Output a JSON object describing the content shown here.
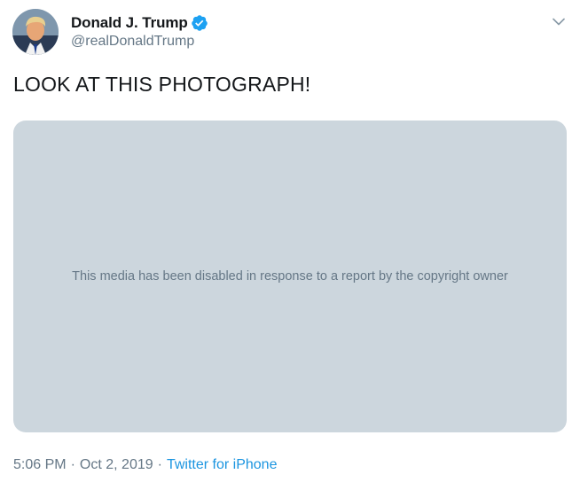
{
  "author": {
    "display_name": "Donald J. Trump",
    "handle": "@realDonaldTrump",
    "verified_icon": "verified-badge-icon",
    "avatar": "profile-photo"
  },
  "menu": {
    "icon": "chevron-down-icon"
  },
  "tweet": {
    "text": "LOOK AT THIS PHOTOGRAPH!"
  },
  "media": {
    "notice": "This media has been disabled in response to a report by the copyright owner"
  },
  "meta": {
    "time": "5:06 PM",
    "separator_1": "·",
    "date": "Oct 2, 2019",
    "separator_2": "·",
    "source": "Twitter for iPhone"
  },
  "colors": {
    "text_primary": "#14171a",
    "text_secondary": "#657786",
    "accent": "#1b95e0",
    "media_placeholder": "#ccd6dd",
    "verified": "#1da1f2"
  }
}
